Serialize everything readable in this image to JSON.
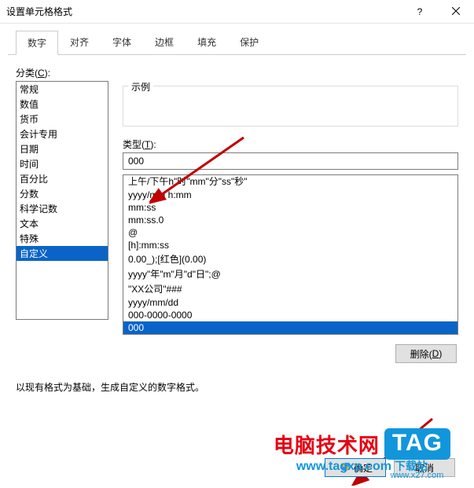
{
  "window": {
    "title": "设置单元格格式"
  },
  "tabs": [
    {
      "label": "数字",
      "active": true
    },
    {
      "label": "对齐",
      "active": false
    },
    {
      "label": "字体",
      "active": false
    },
    {
      "label": "边框",
      "active": false
    },
    {
      "label": "填充",
      "active": false
    },
    {
      "label": "保护",
      "active": false
    }
  ],
  "category": {
    "label_prefix": "分类(",
    "label_key": "C",
    "label_suffix": "):",
    "items": [
      {
        "label": "常规"
      },
      {
        "label": "数值"
      },
      {
        "label": "货币"
      },
      {
        "label": "会计专用"
      },
      {
        "label": "日期"
      },
      {
        "label": "时间"
      },
      {
        "label": "百分比"
      },
      {
        "label": "分数"
      },
      {
        "label": "科学记数"
      },
      {
        "label": "文本"
      },
      {
        "label": "特殊"
      },
      {
        "label": "自定义",
        "selected": true
      }
    ]
  },
  "sample": {
    "label": "示例",
    "value": ""
  },
  "type": {
    "label_prefix": "类型(",
    "label_key": "T",
    "label_suffix": "):",
    "value": "000"
  },
  "formats": [
    {
      "label": "上午/下午h\"时\"mm\"分\"ss\"秒\""
    },
    {
      "label": "yyyy/m/d h:mm"
    },
    {
      "label": "mm:ss"
    },
    {
      "label": "mm:ss.0"
    },
    {
      "label": "@"
    },
    {
      "label": "[h]:mm:ss"
    },
    {
      "label": "0.00_);[红色](0.00)"
    },
    {
      "label": "yyyy\"年\"m\"月\"d\"日\";@"
    },
    {
      "label": "\"XX公司\"###"
    },
    {
      "label": "yyyy/mm/dd"
    },
    {
      "label": "000-0000-0000"
    },
    {
      "label": "000",
      "selected": true
    }
  ],
  "delete": {
    "label_prefix": "删除(",
    "label_key": "D",
    "label_suffix": ")"
  },
  "note": "以现有格式为基础，生成自定义的数字格式。",
  "buttons": {
    "ok_prefix": "",
    "ok": "确定",
    "cancel": "取消"
  },
  "watermark": {
    "cn": "电脑技术网",
    "tag": "TAG",
    "url": "www.tagxp.com",
    "sub": "下载站",
    "suburl": "www.x27.com"
  }
}
